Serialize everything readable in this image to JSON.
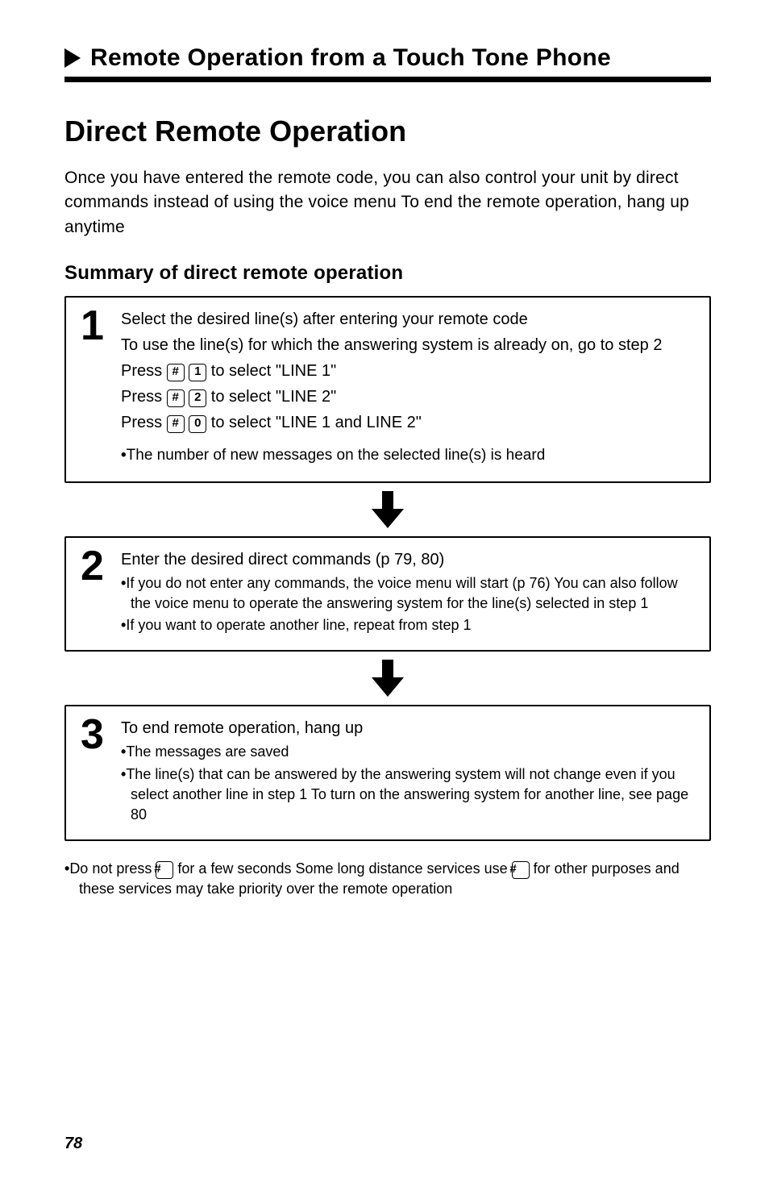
{
  "header": {
    "title": "Remote Operation from a Touch Tone Phone"
  },
  "main_title": "Direct Remote Operation",
  "intro": "Once you have entered the remote code, you can also control your unit by direct commands instead of using the voice menu  To end the remote operation, hang up anytime",
  "sub_title": "Summary of direct remote operation",
  "steps": {
    "s1": {
      "num": "1",
      "l1": "Select the desired line(s) after entering your remote code",
      "l2": "To use the line(s) for which the answering system is already on, go to step 2",
      "p1a": "Press ",
      "p1b": " to select \"LINE 1\"",
      "p2a": "Press ",
      "p2b": " to select \"LINE 2\"",
      "p3a": "Press ",
      "p3b": " to select \"LINE 1 and LINE 2\"",
      "note1": "The number of new messages on the selected line(s) is heard"
    },
    "s2": {
      "num": "2",
      "l1": "Enter the desired direct commands (p  79, 80)",
      "note1": "If you do not enter any commands, the voice menu will start (p  76)  You can also follow the voice menu to operate the answering system for the line(s) selected in step 1",
      "note2": "If you want to operate another line, repeat from step 1"
    },
    "s3": {
      "num": "3",
      "l1": "To end remote operation, hang up",
      "note1": "The messages are saved",
      "note2": "The line(s) that can be answered by the answering system will not change even if you select another line in step 1  To turn on the answering system for another line, see page 80"
    }
  },
  "keys": {
    "hash": "#",
    "one": "1",
    "two": "2",
    "zero": "0"
  },
  "footnote_a": "Do not press ",
  "footnote_b": " for a few seconds  Some long distance services use ",
  "footnote_c": " for other purposes and these services may take priority over the remote operation",
  "page_number": "78"
}
